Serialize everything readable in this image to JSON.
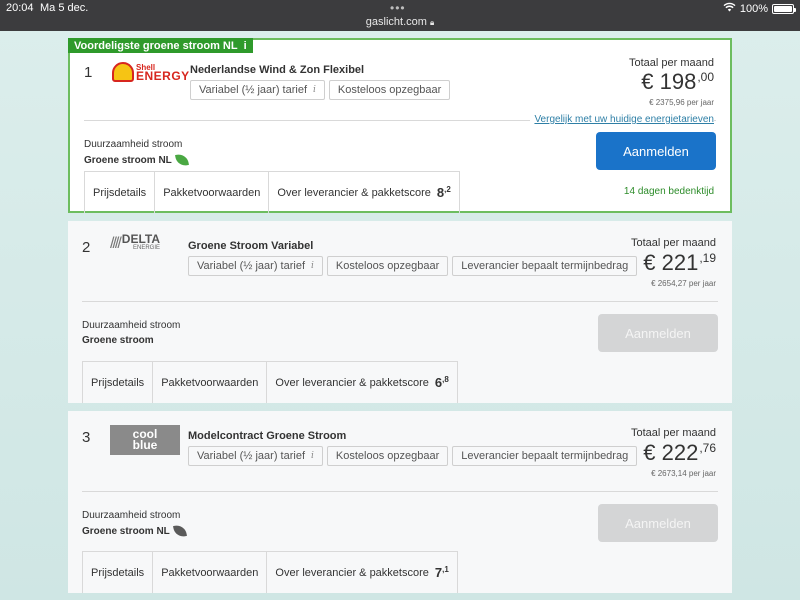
{
  "status_bar": {
    "time": "20:04",
    "date": "Ma 5 dec.",
    "url": "gaslicht.com",
    "battery": "100%"
  },
  "badge": {
    "label": "Voordeligste groene stroom NL",
    "info_icon": "i"
  },
  "offers": [
    {
      "rank": "1",
      "logo_name": "shell-energy-logo",
      "logo_text": [
        "Shell",
        "ENERGY"
      ],
      "package_name": "Nederlandse Wind & Zon Flexibel",
      "tags": [
        "Variabel (½ jaar) tarief",
        "Kosteloos opzegbaar"
      ],
      "price_label": "Totaal per maand",
      "price_main": "€ 198",
      "price_cents": ",00",
      "price_year": "€ 2375,96 per jaar",
      "compare_link": "Vergelijk met uw huidige energietarieven",
      "sust_label": "Duurzaamheid stroom",
      "sust_value": "Groene stroom NL",
      "button": "Aanmelden",
      "cooling_off": "14 dagen bedenktijd",
      "tabs": [
        "Prijsdetails",
        "Pakketvoorwaarden",
        "Over leverancier & pakketscore"
      ],
      "score_main": "8",
      "score_dec": ",2"
    },
    {
      "rank": "2",
      "logo_name": "delta-energie-logo",
      "logo_text": [
        "DELTA",
        "ENERGIE"
      ],
      "package_name": "Groene Stroom Variabel",
      "tags": [
        "Variabel (½ jaar) tarief",
        "Kosteloos opzegbaar",
        "Leverancier bepaalt termijnbedrag"
      ],
      "price_label": "Totaal per maand",
      "price_main": "€ 221",
      "price_cents": ",19",
      "price_year": "€ 2654,27 per jaar",
      "sust_label": "Duurzaamheid stroom",
      "sust_value": "Groene stroom",
      "button": "Aanmelden",
      "tabs": [
        "Prijsdetails",
        "Pakketvoorwaarden",
        "Over leverancier & pakketscore"
      ],
      "score_main": "6",
      "score_dec": ",8"
    },
    {
      "rank": "3",
      "logo_name": "coolblue-logo",
      "logo_text": [
        "cool",
        "blue"
      ],
      "package_name": "Modelcontract Groene Stroom",
      "tags": [
        "Variabel (½ jaar) tarief",
        "Kosteloos opzegbaar",
        "Leverancier bepaalt termijnbedrag"
      ],
      "price_label": "Totaal per maand",
      "price_main": "€ 222",
      "price_cents": ",76",
      "price_year": "€ 2673,14 per jaar",
      "sust_label": "Duurzaamheid stroom",
      "sust_value": "Groene stroom NL",
      "button": "Aanmelden",
      "tabs": [
        "Prijsdetails",
        "Pakketvoorwaarden",
        "Over leverancier & pakketscore"
      ],
      "score_main": "7",
      "score_dec": ",1"
    }
  ],
  "colors": {
    "primary_button": "#1a73c9",
    "best_badge": "#2f9a2b",
    "best_border": "#6dbd5f",
    "cooling_text": "#2d8c2a",
    "link": "#2e7fa6",
    "disabled_button": "#d4d5d6"
  }
}
